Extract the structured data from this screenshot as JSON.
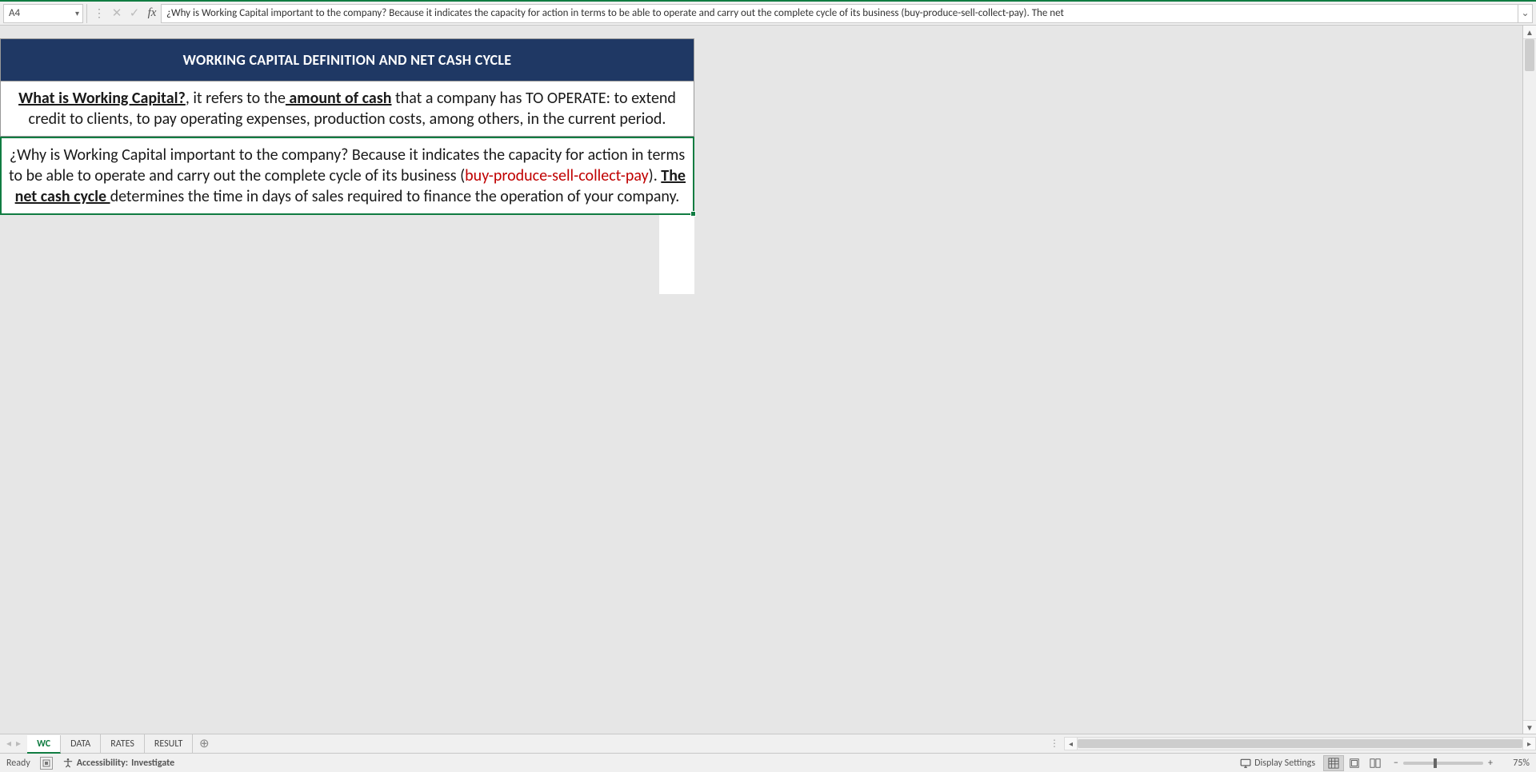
{
  "formulaBar": {
    "cellRef": "A4",
    "content": "¿Why is Working Capital important to the company? Because it indicates the capacity for action in terms to be able to operate and carry out the complete cycle of its business (buy-produce-sell-collect-pay). The net"
  },
  "sheet": {
    "title": "WORKING CAPITAL DEFINITION AND NET CASH CYCLE",
    "row1": {
      "lead": "What is Working Capital?",
      "mid1": ", it refers to the",
      "amount": " amount of cash",
      "tail": " that a company has TO OPERATE: to extend credit to clients, to  pay operating expenses, production costs, among others, in the current period."
    },
    "row2": {
      "p1": "¿Why is Working Capital important to the company? Because it indicates the capacity for action in terms to be able to operate and carry out the complete cycle of its business (",
      "red": "buy-produce-sell-collect-pay",
      "p2": "). ",
      "u": "The net cash cycle ",
      "p3": "determines the time in days of sales required to finance the operation of your company."
    }
  },
  "tabs": {
    "items": [
      "WC",
      "DATA",
      "RATES",
      "RESULT"
    ],
    "activeIndex": 0
  },
  "status": {
    "ready": "Ready",
    "accessibility_label": "Accessibility:",
    "accessibility_value": "Investigate",
    "displaySettings": "Display Settings",
    "zoom": "75%"
  }
}
